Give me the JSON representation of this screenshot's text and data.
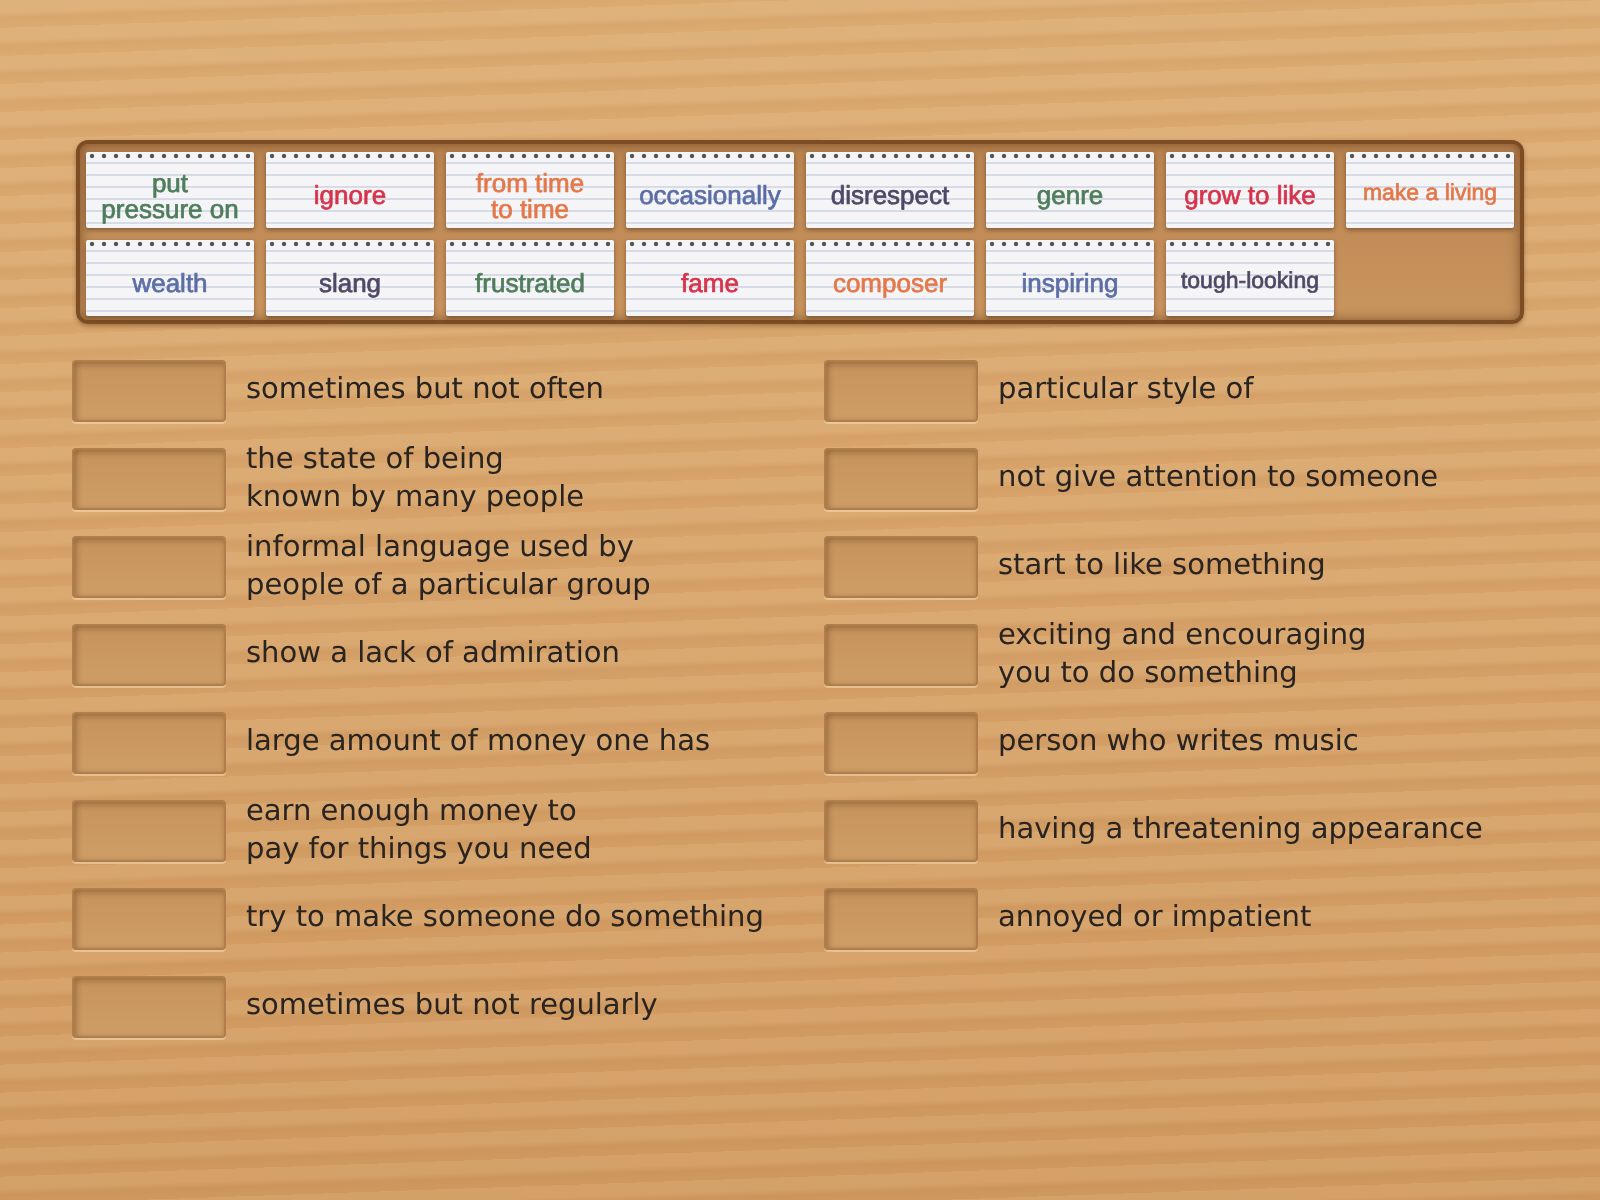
{
  "cards": [
    {
      "text": "put\npressure on",
      "color": "#4f7d5c"
    },
    {
      "text": "ignore",
      "color": "#d7334a"
    },
    {
      "text": "from time\nto time",
      "color": "#e4784a"
    },
    {
      "text": "occasionally",
      "color": "#5b6ea6"
    },
    {
      "text": "disrespect",
      "color": "#4f4866"
    },
    {
      "text": "genre",
      "color": "#4f7d5c"
    },
    {
      "text": "grow to like",
      "color": "#d7334a"
    },
    {
      "text": "make a living",
      "color": "#e4784a"
    },
    {
      "text": "wealth",
      "color": "#5b6ea6"
    },
    {
      "text": "slang",
      "color": "#4f4866"
    },
    {
      "text": "frustrated",
      "color": "#4f7d5c"
    },
    {
      "text": "fame",
      "color": "#d7334a"
    },
    {
      "text": "composer",
      "color": "#e4784a"
    },
    {
      "text": "inspiring",
      "color": "#5b6ea6"
    },
    {
      "text": "tough-looking",
      "color": "#4f4866"
    }
  ],
  "definition_columns": [
    {
      "items": [
        {
          "text": "sometimes but not often"
        },
        {
          "text": "the state of being\nknown by many people"
        },
        {
          "text": "informal language used by\npeople of a particular group"
        },
        {
          "text": "show a lack of admiration"
        },
        {
          "text": "large amount of money one has"
        },
        {
          "text": "earn enough money to\npay for things you need"
        },
        {
          "text": "try to make someone do something"
        },
        {
          "text": "sometimes but not regularly"
        }
      ]
    },
    {
      "items": [
        {
          "text": "particular style of"
        },
        {
          "text": "not give attention to someone"
        },
        {
          "text": "start to like something"
        },
        {
          "text": "exciting and encouraging\nyou to do something"
        },
        {
          "text": "person who writes music"
        },
        {
          "text": "having a threatening appearance"
        },
        {
          "text": "annoyed or impatient"
        }
      ]
    }
  ]
}
